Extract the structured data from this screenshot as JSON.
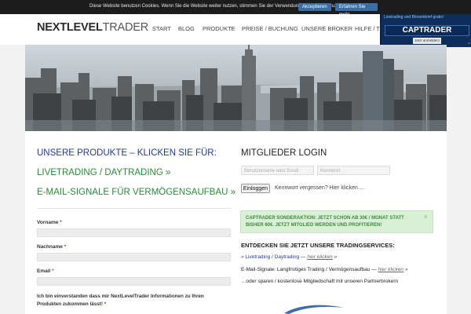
{
  "cookie_bar": {
    "text": "Diese Website benutzen Cookies. Wenn Sie die Website weiter nutzen, stimmen Sie der Verwendung von Cookies zu.",
    "accept_label": "Akzeptieren",
    "more_label": "Erfahren Sie mehr"
  },
  "header": {
    "logo_bold": "NEXTLEVEL",
    "logo_light": "TRADER",
    "nav": [
      "START",
      "BLOG",
      "PRODUKTE",
      "PREISE / BUCHUNG",
      "UNSERE BROKER",
      "HILFE / TO"
    ]
  },
  "ad": {
    "top_text": "Livetrading und Börsenbrief gratis!",
    "logo_text": "CAPTRADER",
    "button_label": "Jetzt anmelden!",
    "close": "×"
  },
  "left": {
    "title": "UNSERE PRODUKTE – KLICKEN SIE FÜR:",
    "link_live": "LIVETRADING / DAYTRADING »",
    "link_email": "E-MAIL-SIGNALE FÜR VERMÖGENSAUFBAU »",
    "form": {
      "vorname": "Vorname",
      "nachname": "Nachname",
      "email": "Email",
      "required": "*",
      "consent": "Ich bin einverstanden dass mir NextLevelTrader Informationen zu Ihren Produkten zukommen lässt!",
      "consent_required": "*"
    }
  },
  "login": {
    "title": "MITGLIEDER LOGIN",
    "username_placeholder": "Benutzername oder Email",
    "password_placeholder": "Kennwort",
    "button": "Einloggen",
    "forgot": "Kennwort vergessen? Hier klicken…."
  },
  "promo": {
    "text": "CAPTRADER SONDERAKTION: JETZT SCHON AB 30€ / MONAT STATT BISHER 60€. JETZT MITGLIED WERDEN UND PROFITIEREN!",
    "close": "×"
  },
  "services": {
    "title": "ENTDECKEN SIE JETZT UNSERE TRADINGSERVICES:",
    "item1_title": "» Livetrading / Daytrading —",
    "item1_link": "hier klicken",
    "item1_arrow": "»",
    "item2_title": "E-Mail-Signale: Langfristiges Trading / Vermögensaufbau —",
    "item2_link": "hier klicken",
    "item2_arrow": "»",
    "item3_title": "…oder sparen / kostenlose Mitgliedschaft mit unseren Partnerbrokern"
  },
  "colors": {
    "brand_blue": "#243a8c",
    "link_green": "#2a8a3a",
    "cookie_button": "#3a6ea5"
  }
}
